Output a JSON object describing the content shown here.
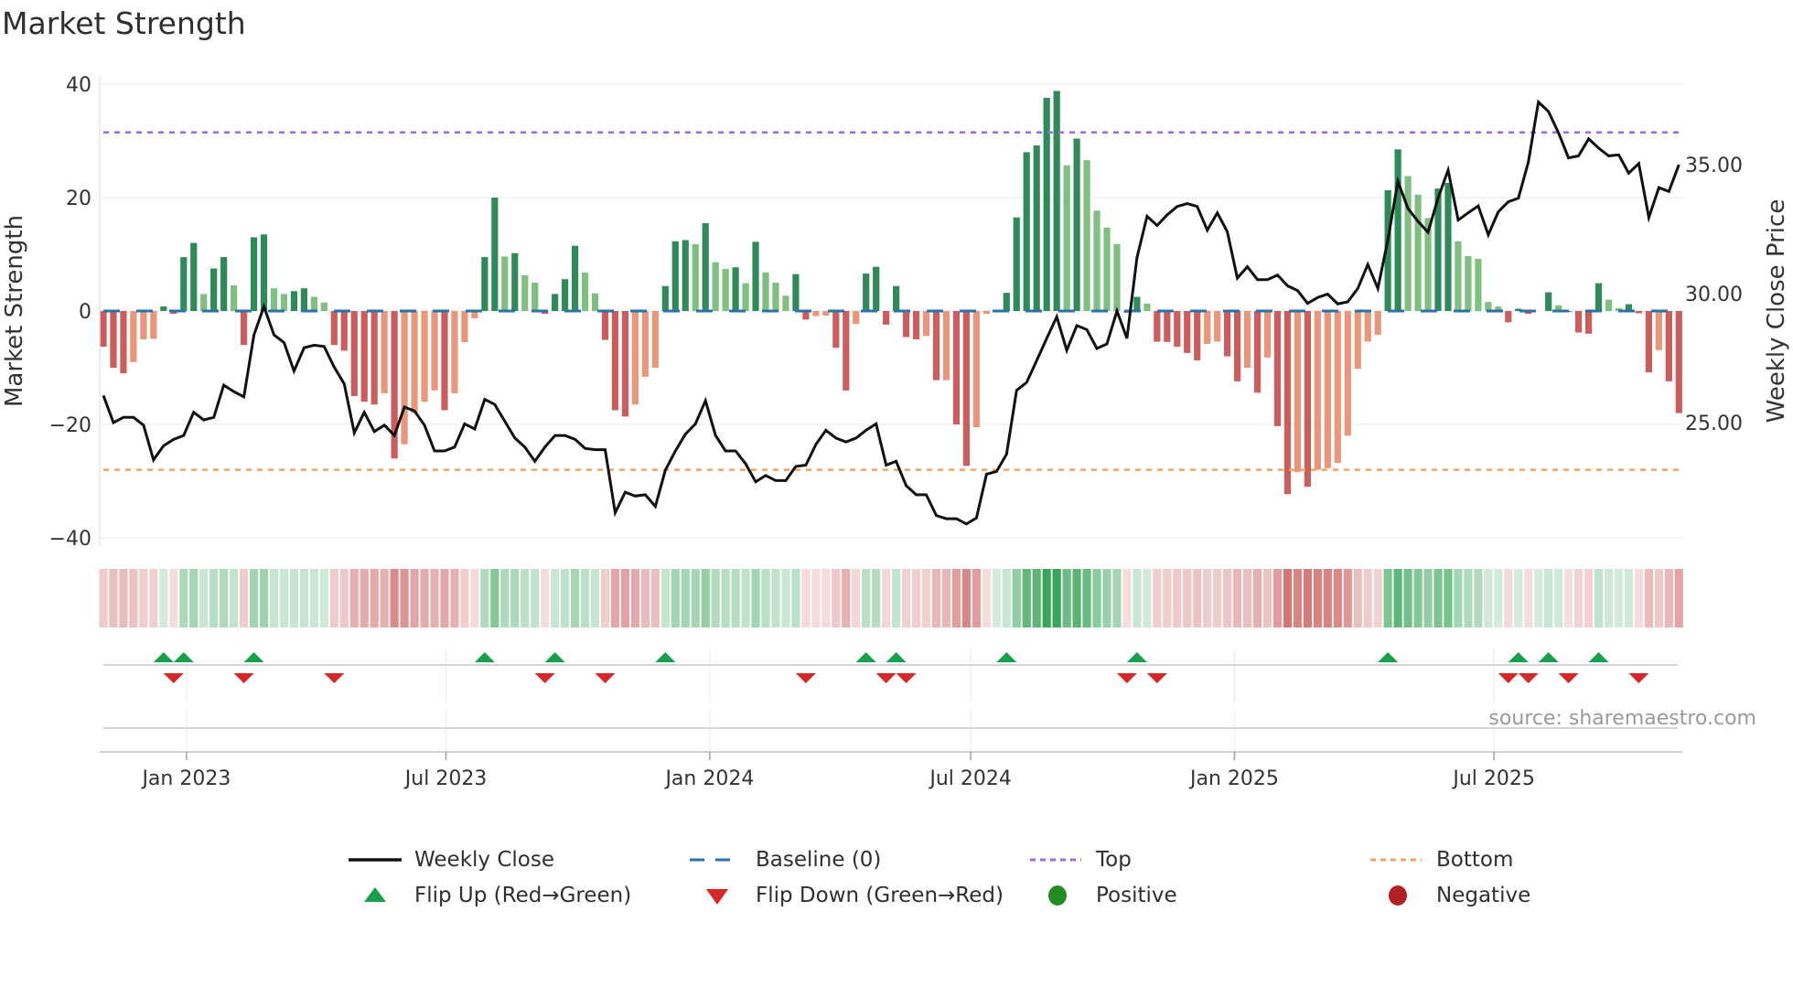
{
  "title": "Market Strength",
  "source": "source: sharemaestro.com",
  "chart_data": {
    "type": "bar",
    "title": "Market Strength",
    "frequency": "weekly",
    "start_date": "2022-11-04",
    "ylabel": "Market Strength",
    "y2label": "Weekly Close Price",
    "ylim": [
      -40,
      40
    ],
    "y2lim": [
      20.53,
      38.12
    ],
    "grid": true,
    "yticks": [
      {
        "v": 40,
        "label": "40"
      },
      {
        "v": 20,
        "label": "20"
      },
      {
        "v": 0,
        "label": "0"
      },
      {
        "v": -20,
        "label": "−20"
      },
      {
        "v": -40,
        "label": "−40"
      }
    ],
    "y2ticks": [
      {
        "v": 35,
        "label": "35.00"
      },
      {
        "v": 30,
        "label": "30.00"
      },
      {
        "v": 25,
        "label": "25.00"
      }
    ],
    "xticks": [
      {
        "date": "2023-01-01",
        "label": "Jan 2023"
      },
      {
        "date": "2023-07-01",
        "label": "Jul 2023"
      },
      {
        "date": "2024-01-01",
        "label": "Jan 2024"
      },
      {
        "date": "2024-07-01",
        "label": "Jul 2024"
      },
      {
        "date": "2025-01-01",
        "label": "Jan 2025"
      },
      {
        "date": "2025-07-01",
        "label": "Jul 2025"
      }
    ],
    "top_level": 31.5,
    "bottom_level": -28,
    "baseline": 0,
    "strength": [
      -6.3,
      -10,
      -11,
      -9,
      -5,
      -4.9,
      0.8,
      -0.5,
      9.5,
      12,
      3,
      7.5,
      9.5,
      4.5,
      -6,
      13,
      13.5,
      4,
      3,
      3.5,
      4,
      2.5,
      1.5,
      -6,
      -7,
      -15,
      -16,
      -16.5,
      -14.5,
      -26,
      -23.5,
      -18,
      -16,
      -14,
      -17.5,
      -14.5,
      -5.5,
      -1.3,
      9.5,
      20,
      9.6,
      10.2,
      6.3,
      5,
      -0.5,
      3,
      5.6,
      11.5,
      6.8,
      3.1,
      -5.1,
      -17.5,
      -18.6,
      -16.5,
      -11.6,
      -10,
      4.4,
      12.3,
      12.5,
      11.8,
      15.5,
      8.6,
      7.4,
      7.7,
      4.9,
      12.2,
      6.8,
      5,
      2.7,
      6.5,
      -1.5,
      -0.9,
      -0.8,
      -6.5,
      -14,
      -2.3,
      6.6,
      7.8,
      -2.4,
      4.4,
      -4.6,
      -5,
      -4.4,
      -12.2,
      -12.2,
      -20,
      -27.3,
      -20.5,
      -0.5,
      0,
      3.2,
      16.5,
      28,
      29.2,
      37.6,
      38.8,
      25.7,
      30.4,
      26.6,
      17.7,
      14.7,
      11.8,
      -0.3,
      2.5,
      1.3,
      -5.4,
      -5.45,
      -6.3,
      -7.4,
      -8.7,
      -5.8,
      -5.4,
      -8,
      -12.4,
      -10,
      -14.4,
      -8.2,
      -20.3,
      -32.3,
      -28.4,
      -31,
      -28,
      -27.7,
      -26.8,
      -22,
      -10.2,
      -5.4,
      -4.2,
      21.3,
      28.5,
      23.8,
      20.5,
      16.4,
      21.6,
      22.6,
      12.3,
      9.7,
      9.2,
      1.6,
      0.8,
      -2,
      0.4,
      -0.5,
      0,
      3.3,
      1,
      -0.2,
      -3.8,
      -4,
      4.9,
      2,
      0.5,
      1.2,
      -0.4,
      -10.8,
      -6.9,
      -12.4,
      -18
    ],
    "weekly_close": [
      26.05,
      25.0,
      25.2,
      25.2,
      24.9,
      23.55,
      24.1,
      24.35,
      24.5,
      25.4,
      25.1,
      25.2,
      26.45,
      26.2,
      26.0,
      28.4,
      29.5,
      28.4,
      28.1,
      27.0,
      27.9,
      28.0,
      27.95,
      27.15,
      26.5,
      24.6,
      25.4,
      24.65,
      24.9,
      24.5,
      25.6,
      25.45,
      24.9,
      23.9,
      23.9,
      24.05,
      24.95,
      24.75,
      25.9,
      25.7,
      25.05,
      24.4,
      24.05,
      23.5,
      24.05,
      24.5,
      24.5,
      24.35,
      24.0,
      23.95,
      23.95,
      21.5,
      22.3,
      22.15,
      22.2,
      21.75,
      23.15,
      23.9,
      24.55,
      24.95,
      25.85,
      24.5,
      23.9,
      23.9,
      23.4,
      22.7,
      22.95,
      22.75,
      22.75,
      23.3,
      23.35,
      24.15,
      24.7,
      24.4,
      24.25,
      24.4,
      24.7,
      24.95,
      23.35,
      23.5,
      22.55,
      22.2,
      22.2,
      21.4,
      21.27,
      21.27,
      21.07,
      21.3,
      23.0,
      23.1,
      23.77,
      26.25,
      26.55,
      27.4,
      28.26,
      29.1,
      27.8,
      28.76,
      28.6,
      27.87,
      28.05,
      29.33,
      28.26,
      31.4,
      33.0,
      32.64,
      33.05,
      33.38,
      33.49,
      33.38,
      32.46,
      33.13,
      32.4,
      30.6,
      31.04,
      30.54,
      30.54,
      30.72,
      30.3,
      30.12,
      29.62,
      29.85,
      29.98,
      29.6,
      29.68,
      30.2,
      31.13,
      30.2,
      32.1,
      34.35,
      33.3,
      32.8,
      32.38,
      33.7,
      34.79,
      32.85,
      33.13,
      33.4,
      32.28,
      33.17,
      33.56,
      33.7,
      35.1,
      37.43,
      37.06,
      36.23,
      35.26,
      35.34,
      36.0,
      35.64,
      35.34,
      35.38,
      34.67,
      35.04,
      32.95,
      34.11,
      33.96,
      35.0
    ],
    "colors": {
      "pos_strong": "#2e8b57",
      "pos_weak": "#7fbf7f",
      "neg_strong": "#cd5c5c",
      "neg_weak": "#e9967a",
      "close_line": "#111111",
      "baseline": "#2a72a8",
      "top": "#9e6be0",
      "bottom": "#f2a45c",
      "flip_up": "#17a04a",
      "flip_down": "#d62728",
      "positive": "#228b22",
      "negative": "#b22222"
    },
    "legend": {
      "placement": "bottom",
      "weekly_close": "Weekly Close",
      "baseline": "Baseline (0)",
      "top": "Top",
      "bottom": "Bottom",
      "flip_up": "Flip Up (Red→Green)",
      "flip_down": "Flip Down (Green→Red)",
      "positive": "Positive",
      "negative": "Negative"
    }
  }
}
